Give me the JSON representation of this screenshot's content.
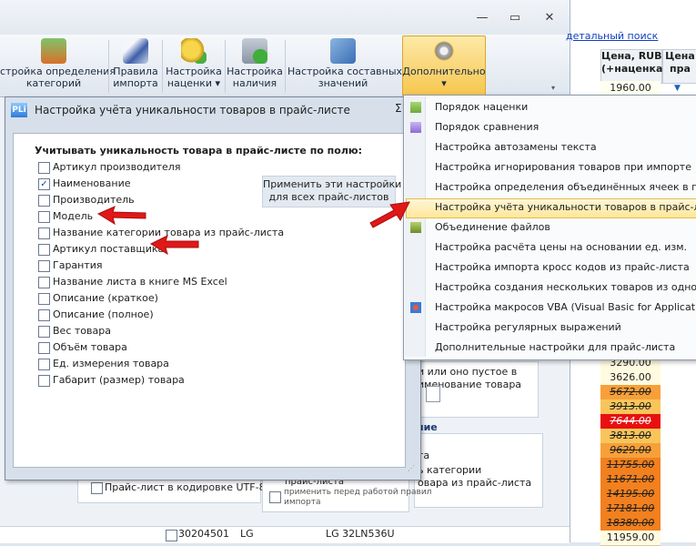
{
  "window": {
    "controls": [
      "—",
      "▭",
      "✕"
    ]
  },
  "ribbon": {
    "buttons": [
      {
        "label": "стройка определения\nкатегорий"
      },
      {
        "label": "Правила\nимпорта"
      },
      {
        "label": "Настройка\nнаценки ▾"
      },
      {
        "label": "Настройка\nналичия"
      },
      {
        "label": "Настройка составных\nзначений"
      },
      {
        "label": "Дополнительно\n▾"
      }
    ]
  },
  "right_panel": {
    "search_link": "детальный поиск",
    "col1_header": "Цена, RUB\n(+наценка)",
    "col2_header": "Цена\nпра",
    "prices": [
      "1960.00",
      "3290.00",
      "3626.00",
      "5672.00",
      "3913.00",
      "7644.00",
      "3813.00",
      "9629.00",
      "11755.00",
      "11671.00",
      "14195.00",
      "17181.00",
      "18380.00",
      "11959.00"
    ],
    "price_colors": [
      "#fffff0",
      "#fffbe0",
      "#fffbe0",
      "#f7a03a",
      "#f9c55a",
      "#e81010",
      "#f9c55a",
      "#f7a03a",
      "#f2801e",
      "#f2801e",
      "#f2801e",
      "#f2801e",
      "#f2801e",
      "#fffbe0"
    ]
  },
  "background_text": {
    "rule_text": "и или оно пустое в\nименование товара",
    "section_title": "ние\nиовании:",
    "ta_letter": "та",
    "category_text": "ь категории\nовара из прайс-листа",
    "utf8_label": "Прайс-лист в кодировке UTF-8",
    "price_list_label": "прайс-листа",
    "apply_before": "применить перед работой правил\nимпорта",
    "row_code": "30204501",
    "row_brand": "LG",
    "row_model": "LG 32LN536U"
  },
  "dialog": {
    "title": "Настройка учёта уникальности товаров в прайс-листе",
    "title_close": "Σ",
    "heading": "Учитывать уникальность товара в прайс-листе по полю:",
    "apply_all": "Применить эти настройки\nдля всех прайс-листов",
    "fields": [
      {
        "label": "Артикул производителя",
        "checked": false
      },
      {
        "label": "Наименование",
        "checked": true
      },
      {
        "label": "Производитель",
        "checked": false
      },
      {
        "label": "Модель",
        "checked": false
      },
      {
        "label": "Название категории товара из прайс-листа",
        "checked": false
      },
      {
        "label": "Артикул поставщика",
        "checked": false
      },
      {
        "label": "Гарантия",
        "checked": false
      },
      {
        "label": "Название листа в книге MS Excel",
        "checked": false
      },
      {
        "label": "Описание (краткое)",
        "checked": false
      },
      {
        "label": "Описание (полное)",
        "checked": false
      },
      {
        "label": "Вес товара",
        "checked": false
      },
      {
        "label": "Объём товара",
        "checked": false
      },
      {
        "label": "Ед. измерения товара",
        "checked": false
      },
      {
        "label": "Габарит (размер) товара",
        "checked": false
      }
    ]
  },
  "menu": {
    "items": [
      "Порядок наценки",
      "Порядок сравнения",
      "Настройка автозамены текста",
      "Настройка игнорирования товаров при импорте",
      "Настройка определения объединённых ячеек в прай",
      "Настройка учёта уникальности товаров в прайс-листе",
      "Объединение файлов",
      "Настройка расчёта цены на основании ед. изм.",
      "Настройка импорта кросс кодов из прайс-листа",
      "Настройка создания нескольких товаров из одного то",
      "Настройка макросов VBA (Visual Basic for Applications",
      "Настройка регулярных выражений",
      "Дополнительные настройки для прайс-листа"
    ],
    "highlighted_index": 5
  },
  "colors": {
    "accent": "#f6c64d",
    "arrow": "#e01818",
    "link": "#1040c0"
  }
}
